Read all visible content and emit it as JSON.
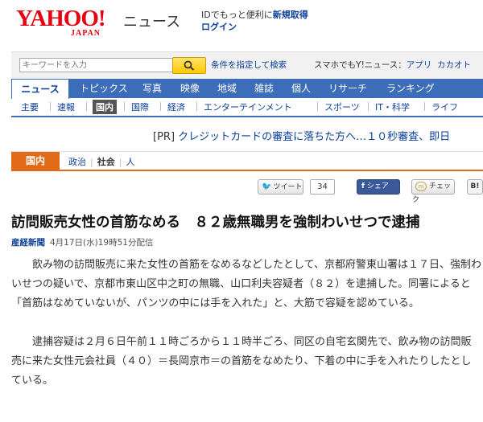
{
  "header": {
    "logo_text": "YAHOO!",
    "logo_sub": "JAPAN",
    "section_word": "ニュース",
    "id_promo_prefix": "IDでもっと便利に",
    "id_promo_link": "新規取得",
    "login": "ログイン"
  },
  "search": {
    "placeholder": "キーワードを入力",
    "advanced_link": "条件を指定して検索",
    "sp_prefix": "スマホでもY!ニュース：",
    "sp_links": [
      "アプリ",
      "カカオト"
    ]
  },
  "main_nav": [
    "ニュース",
    "トピックス",
    "写真",
    "映像",
    "地域",
    "雑誌",
    "個人",
    "リサーチ",
    "ランキング"
  ],
  "sub_nav": [
    "主要",
    "速報",
    "国内",
    "国際",
    "経済",
    "エンターテインメント",
    "スポーツ",
    "IT・科学",
    "ライフ"
  ],
  "pr": {
    "tag": "[PR]",
    "text": "クレジットカードの審査に落ちた方へ…１０秒審査、即日"
  },
  "category": {
    "badge": "国内",
    "items": [
      "政治",
      "社会",
      "人"
    ],
    "current": "社会"
  },
  "share": {
    "tweet_label": "ツイート",
    "tweet_count": "34",
    "facebook_label": "シェア",
    "mixi_label": "チェック",
    "hatena_label": "B!"
  },
  "article": {
    "headline": "訪問販売女性の首筋なめる　８２歳無職男を強制わいせつで逮捕",
    "source": "産経新聞",
    "date": "4月17日(水)19時51分配信",
    "paragraphs": [
      "飲み物の訪問販売に来た女性の首筋をなめるなどしたとして、京都府警東山署は１７日、強制わいせつの疑いで、京都市東山区中之町の無職、山口利夫容疑者（８２）を逮捕した。同署によると「首筋はなめていないが、パンツの中には手を入れた」と、大筋で容疑を認めている。",
      "逮捕容疑は２月６日午前１１時ごろから１１時半ごろ、同区の自宅玄関先で、飲み物の訪問販売に来た女性元会社員（４０）＝長岡京市＝の首筋をなめたり、下着の中に手を入れたりしたとしている。"
    ]
  },
  "colors": {
    "brand": "#e60012",
    "nav": "#3d6cb8",
    "category": "#e26b1a",
    "link": "#0b3f99"
  }
}
